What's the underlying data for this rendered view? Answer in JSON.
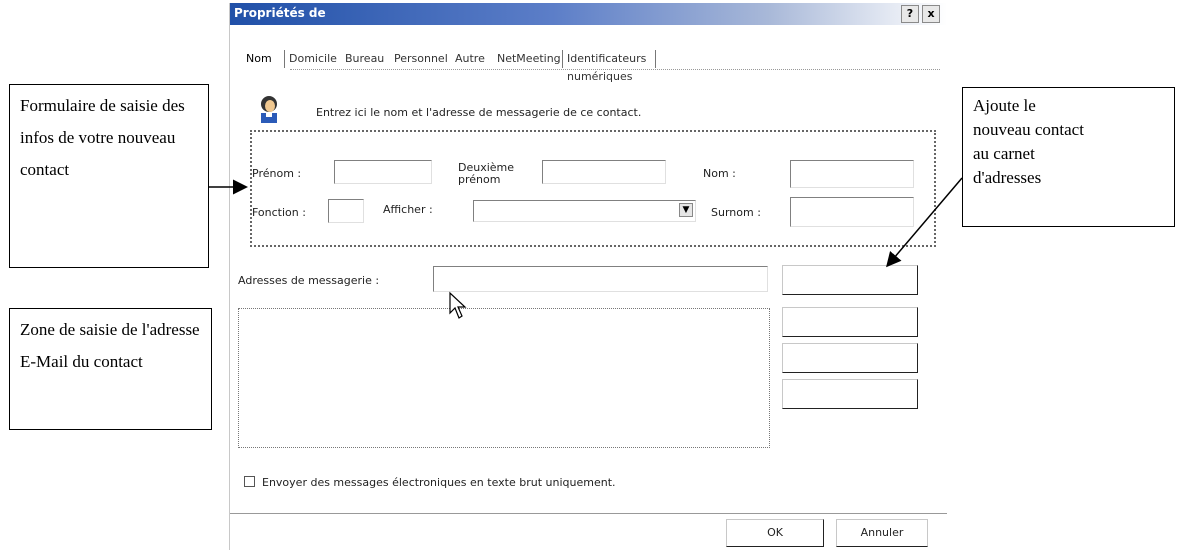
{
  "window": {
    "title": "Propriétés de",
    "help_label": "?",
    "close_label": "x"
  },
  "tabs": [
    {
      "label": "Nom",
      "selected": true
    },
    {
      "label": "Domicile"
    },
    {
      "label": "Bureau"
    },
    {
      "label": "Personnel"
    },
    {
      "label": "Autre"
    },
    {
      "label": "NetMeeting"
    },
    {
      "label": "Identificateurs numériques"
    }
  ],
  "intro_text": "Entrez ici le nom et l'adresse de messagerie de ce contact.",
  "form": {
    "prenom_label": "Prénom :",
    "deuxieme_prenom_label_1": "Deuxième",
    "deuxieme_prenom_label_2": "prénom",
    "nom_label": "Nom :",
    "fonction_label": "Fonction :",
    "afficher_label": "Afficher :",
    "surnom_label": "Surnom :",
    "prenom_value": "",
    "deuxieme_prenom_value": "",
    "nom_value": "",
    "fonction_value": "",
    "afficher_value": "",
    "surnom_value": ""
  },
  "email": {
    "label": "Adresses de messagerie :",
    "value": ""
  },
  "checkbox_label": "Envoyer des messages électroniques en texte brut uniquement.",
  "buttons": {
    "ok": "OK",
    "cancel": "Annuler"
  },
  "callouts": {
    "form_info": "Formulaire de saisie des infos de votre nouveau contact",
    "email_zone": "Zone de saisie de l'adresse E-Mail du contact",
    "add_contact_line1": "Ajoute le",
    "add_contact_line2": "nouveau contact",
    "add_contact_line3": "au carnet",
    "add_contact_line4": "d'adresses"
  },
  "colors": {
    "titlebar_start": "#2050a8",
    "titlebar_end": "#ffffff"
  }
}
